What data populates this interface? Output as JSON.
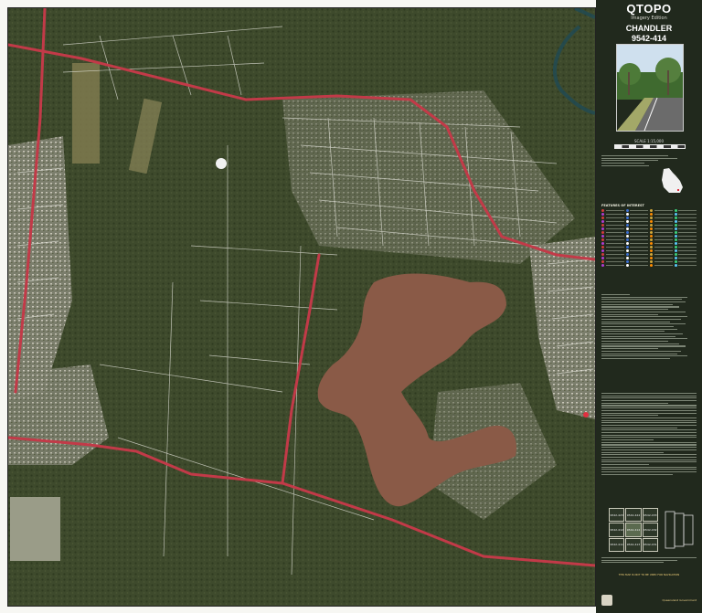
{
  "panel": {
    "brand": "QTOPO",
    "edition": "Imagery Edition",
    "sheet_name": "CHANDLER",
    "sheet_number": "9542-414",
    "scale": "SCALE 1:15,000"
  },
  "map": {
    "place_label": "",
    "reservoir_label": "",
    "colors": {
      "bush": "#3e4a2c",
      "suburb": "#7b7e6c",
      "reservoir": "#8a5a47",
      "road": "#c23a48",
      "street": "#e8e8e0"
    }
  },
  "legend": {
    "title": "FEATURES OF INTEREST",
    "swatch_colors": [
      "#d23b3b",
      "#3b6fd2",
      "#d2a93b",
      "#3bd27a",
      "#b03bd2",
      "#ffffff",
      "#ff8c00",
      "#5ac8fa"
    ]
  },
  "sheet_index": {
    "cells": [
      {
        "num": "9542-423"
      },
      {
        "num": "9542-424"
      },
      {
        "num": "9542-433"
      },
      {
        "num": "9542-412"
      },
      {
        "num": "9542-414",
        "current": true
      },
      {
        "num": "9542-432"
      },
      {
        "num": "9542-411"
      },
      {
        "num": "9542-413"
      },
      {
        "num": "9542-431"
      }
    ]
  },
  "notice": "THIS MAP IS NOT TO BE USED FOR NAVIGATION",
  "publisher": "Queensland Government"
}
